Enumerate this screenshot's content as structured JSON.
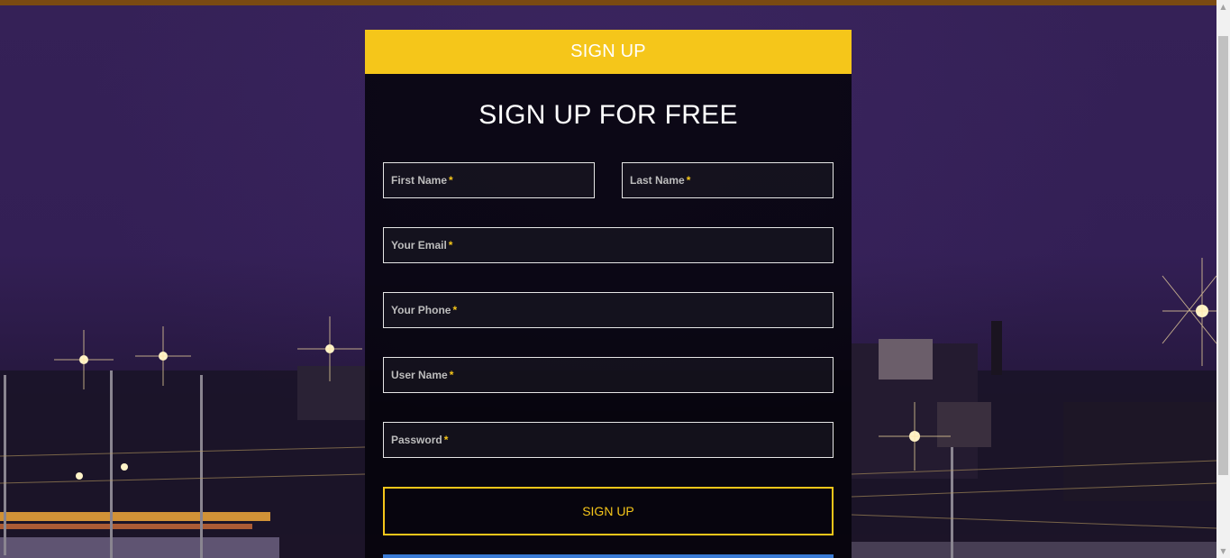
{
  "panel": {
    "header_label": "SIGN UP",
    "title": "SIGN UP FOR FREE",
    "fields": {
      "first_name": {
        "label": "First Name",
        "required_mark": "*"
      },
      "last_name": {
        "label": "Last Name",
        "required_mark": "*"
      },
      "email": {
        "label": "Your Email",
        "required_mark": "*"
      },
      "phone": {
        "label": "Your Phone",
        "required_mark": "*"
      },
      "username": {
        "label": "User Name",
        "required_mark": "*"
      },
      "password": {
        "label": "Password",
        "required_mark": "*"
      }
    },
    "submit_label": "SIGN UP"
  },
  "colors": {
    "accent_yellow": "#f5c61a",
    "panel_background": "#05040a",
    "page_background": "#2e1c4e",
    "partial_button_blue": "#3a7bd5"
  },
  "icons": {
    "scroll_up": "triangle-up",
    "scroll_down": "triangle-down"
  }
}
